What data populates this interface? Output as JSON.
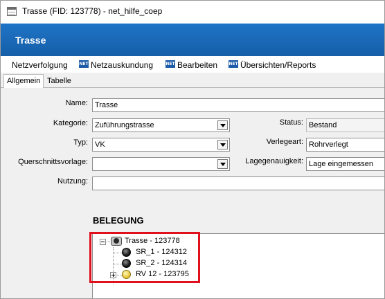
{
  "window": {
    "title": "Trasse (FID: 123778) - net_hilfe_coep"
  },
  "banner": {
    "title": "Trasse",
    "color": "#1a68b8"
  },
  "menu": {
    "items": [
      {
        "label": "Netzverfolgung",
        "icon": null
      },
      {
        "label": "Netzauskundung",
        "icon": "NET"
      },
      {
        "label": "Bearbeiten",
        "icon": "NET"
      },
      {
        "label": "Übersichten/Reports",
        "icon": "NET"
      }
    ]
  },
  "tabs": [
    {
      "label": "Allgemein",
      "active": true
    },
    {
      "label": "Tabelle",
      "active": false
    }
  ],
  "form": {
    "name": {
      "label": "Name:",
      "value": "Trasse"
    },
    "kategorie": {
      "label": "Kategorie:",
      "value": "Zuführungstrasse"
    },
    "typ": {
      "label": "Typ:",
      "value": "VK"
    },
    "querschnitt": {
      "label": "Querschnittsvorlage:",
      "value": ""
    },
    "nutzung": {
      "label": "Nutzung:",
      "value": ""
    },
    "status": {
      "label": "Status:",
      "value": "Bestand"
    },
    "verlegeart": {
      "label": "Verlegeart:",
      "value": "Rohrverlegt"
    },
    "lagegenauigkeit": {
      "label": "Lagegenauigkeit:",
      "value": "Lage eingemessen"
    }
  },
  "belegung": {
    "heading": "BELEGUNG",
    "tree": [
      {
        "label": "Trasse - 123778",
        "icon": "trasse-icon",
        "expanded": true
      },
      {
        "label": "SR_1 - 124312",
        "icon": "black-circle-icon"
      },
      {
        "label": "SR_2 - 124314",
        "icon": "black-circle-icon"
      },
      {
        "label": "RV 12 - 123795",
        "icon": "yellow-circle-icon",
        "expanded": false
      }
    ]
  },
  "highlight_color": "#e0101c"
}
